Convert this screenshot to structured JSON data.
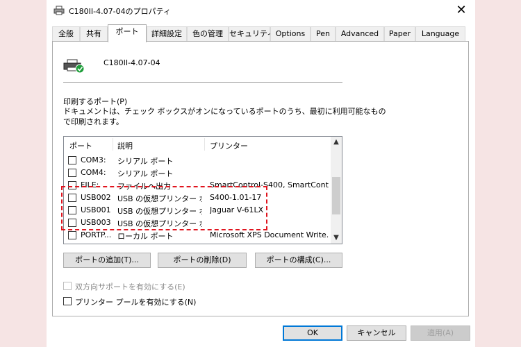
{
  "window": {
    "title": "C180II-4.07-04のプロパティ",
    "close_glyph": "✕"
  },
  "tabs": [
    {
      "label": "全般"
    },
    {
      "label": "共有"
    },
    {
      "label": "ポート",
      "active": true
    },
    {
      "label": "詳細設定"
    },
    {
      "label": "色の管理"
    },
    {
      "label": "セキュリティ"
    },
    {
      "label": "Options"
    },
    {
      "label": "Pen"
    },
    {
      "label": "Advanced"
    },
    {
      "label": "Paper"
    },
    {
      "label": "Language"
    }
  ],
  "printer": {
    "name": "C180II-4.07-04",
    "icon": "printer-default-icon"
  },
  "ports_section": {
    "label": "印刷するポート(P)",
    "description_line1": "ドキュメントは、チェック ボックスがオンになっているポートのうち、最初に利用可能なもの",
    "description_line2": "で印刷されます。"
  },
  "port_list": {
    "columns": [
      "ポート",
      "説明",
      "プリンター"
    ],
    "rows": [
      {
        "port": "COM3:",
        "desc": "シリアル ポート",
        "printer": "",
        "checked": false
      },
      {
        "port": "COM4:",
        "desc": "シリアル ポート",
        "printer": "",
        "checked": false
      },
      {
        "port": "FILE:",
        "desc": "ファイルへ出力",
        "printer": "SmartControl-S400, SmartContr...",
        "checked": false
      },
      {
        "port": "USB002",
        "desc": "USB の仮想プリンター ポ...",
        "printer": "S400-1.01-17",
        "checked": false
      },
      {
        "port": "USB001",
        "desc": "USB の仮想プリンター ポ...",
        "printer": "Jaguar V-61LX",
        "checked": false
      },
      {
        "port": "USB003",
        "desc": "USB の仮想プリンター ポ...",
        "printer": "",
        "checked": false
      },
      {
        "port": "PORTP...",
        "desc": "ローカル ポート",
        "printer": "Microsoft XPS Document Write...",
        "checked": false
      }
    ]
  },
  "port_buttons": {
    "add": "ポートの追加(T)...",
    "delete": "ポートの削除(D)",
    "configure": "ポートの構成(C)..."
  },
  "options": {
    "bidirectional": "双方向サポートを有効にする(E)",
    "pooling": "プリンター プールを有効にする(N)"
  },
  "footer_buttons": {
    "ok": "OK",
    "cancel": "キャンセル",
    "apply": "適用(A)"
  },
  "colors": {
    "highlight": "#e0141e",
    "accent": "#0078d7"
  }
}
